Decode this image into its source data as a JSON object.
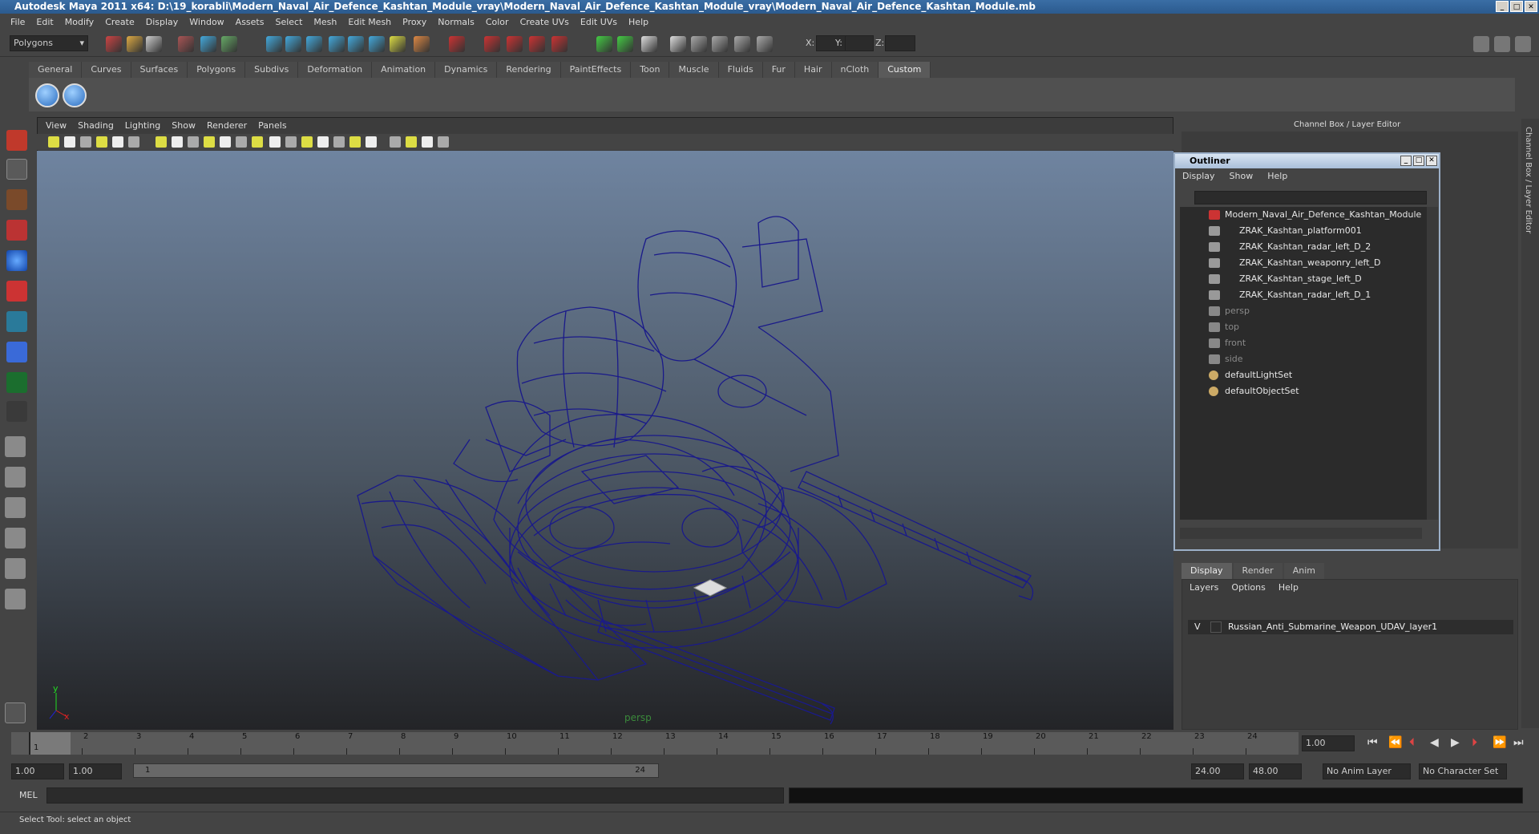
{
  "window": {
    "title": "Autodesk Maya 2011 x64: D:\\19_korabli\\Modern_Naval_Air_Defence_Kashtan_Module_vray\\Modern_Naval_Air_Defence_Kashtan_Module_vray\\Modern_Naval_Air_Defence_Kashtan_Module.mb"
  },
  "menubar": [
    "File",
    "Edit",
    "Modify",
    "Create",
    "Display",
    "Window",
    "Assets",
    "Select",
    "Mesh",
    "Edit Mesh",
    "Proxy",
    "Normals",
    "Color",
    "Create UVs",
    "Edit UVs",
    "Help"
  ],
  "toolbar": {
    "mode": "Polygons",
    "x_label": "X:",
    "y_label": "Y:",
    "z_label": "Z:"
  },
  "shelf_tabs": [
    "General",
    "Curves",
    "Surfaces",
    "Polygons",
    "Subdivs",
    "Deformation",
    "Animation",
    "Dynamics",
    "Rendering",
    "PaintEffects",
    "Toon",
    "Muscle",
    "Fluids",
    "Fur",
    "Hair",
    "nCloth",
    "Custom"
  ],
  "viewport": {
    "menu": [
      "View",
      "Shading",
      "Lighting",
      "Show",
      "Renderer",
      "Panels"
    ],
    "camera_label": "persp",
    "axis_y": "y",
    "axis_x": "x"
  },
  "channel_box": {
    "title": "Channel Box / Layer Editor"
  },
  "outliner": {
    "title": "Outliner",
    "menu": [
      "Display",
      "Show",
      "Help"
    ],
    "items": [
      {
        "label": "Modern_Naval_Air_Defence_Kashtan_Module",
        "dim": false,
        "indent": 0,
        "icon": "transform-icon"
      },
      {
        "label": "ZRAK_Kashtan_platform001",
        "dim": false,
        "indent": 1,
        "icon": "mesh-icon"
      },
      {
        "label": "ZRAK_Kashtan_radar_left_D_2",
        "dim": false,
        "indent": 1,
        "icon": "mesh-icon"
      },
      {
        "label": "ZRAK_Kashtan_weaponry_left_D",
        "dim": false,
        "indent": 1,
        "icon": "mesh-icon"
      },
      {
        "label": "ZRAK_Kashtan_stage_left_D",
        "dim": false,
        "indent": 1,
        "icon": "mesh-icon"
      },
      {
        "label": "ZRAK_Kashtan_radar_left_D_1",
        "dim": false,
        "indent": 1,
        "icon": "mesh-icon"
      },
      {
        "label": "persp",
        "dim": true,
        "indent": 0,
        "icon": "camera-icon"
      },
      {
        "label": "top",
        "dim": true,
        "indent": 0,
        "icon": "camera-icon"
      },
      {
        "label": "front",
        "dim": true,
        "indent": 0,
        "icon": "camera-icon"
      },
      {
        "label": "side",
        "dim": true,
        "indent": 0,
        "icon": "camera-icon"
      },
      {
        "label": "defaultLightSet",
        "dim": false,
        "indent": 0,
        "icon": "set-icon"
      },
      {
        "label": "defaultObjectSet",
        "dim": false,
        "indent": 0,
        "icon": "set-icon"
      }
    ]
  },
  "layer_editor": {
    "tabs": [
      "Display",
      "Render",
      "Anim"
    ],
    "menu": [
      "Layers",
      "Options",
      "Help"
    ],
    "layer": {
      "visible": "V",
      "name": "Russian_Anti_Submarine_Weapon_UDAV_layer1"
    }
  },
  "timeline": {
    "ticks": [
      "1",
      "2",
      "3",
      "4",
      "5",
      "6",
      "7",
      "8",
      "9",
      "10",
      "11",
      "12",
      "13",
      "14",
      "15",
      "16",
      "17",
      "18",
      "19",
      "20",
      "21",
      "22",
      "23",
      "24"
    ],
    "current_frame_label": "1",
    "current_time": "1.00"
  },
  "range": {
    "start_time": "1.00",
    "playback_start": "1.00",
    "slider_start": "1",
    "slider_end": "24",
    "playback_end": "24.00",
    "end_time": "48.00",
    "anim_layer": "No Anim Layer",
    "character_set": "No Character Set"
  },
  "command_line": {
    "label": "MEL"
  },
  "help_line": {
    "text": "Select Tool: select an object"
  },
  "colors": {
    "wireframe": "#1a1a8a",
    "titlebar": "#2b5a8e",
    "panel": "#444444"
  }
}
